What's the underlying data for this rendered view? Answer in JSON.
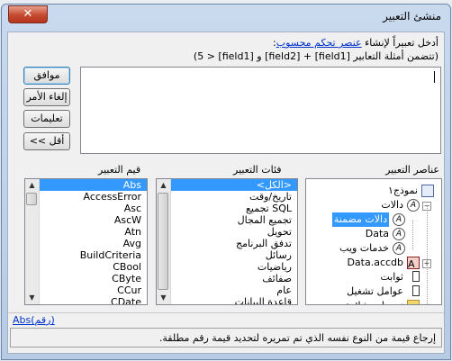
{
  "window": {
    "title": "منشئ التعبير",
    "close_glyph": "✕"
  },
  "instructions": {
    "line1_prefix": "أدخل تعبيراً لإنشاء ",
    "line1_link": "عنصر تحكم محسوب",
    "line1_suffix": ":",
    "line2": "(تتضمن أمثلة التعابير [field1] + [field2] و [field1] < 5)"
  },
  "buttons": {
    "ok": "موافق",
    "cancel": "إلغاء الأمر",
    "help": "تعليمات",
    "less": "<< أقل"
  },
  "panels": {
    "elements_label": "عناصر التعبير",
    "categories_label": "فئات التعبير",
    "values_label": "قيم التعبير"
  },
  "tree": [
    {
      "label": "نموذج١",
      "icon": "form-icon"
    },
    {
      "label": "دالات",
      "icon": "function-icon"
    },
    {
      "label": "دالات مضمنة",
      "icon": "function-icon",
      "selected": true
    },
    {
      "label": "Data",
      "icon": "function-icon"
    },
    {
      "label": "خدمات ويب",
      "icon": "function-icon"
    },
    {
      "label": "Data.accdb",
      "icon": "database-icon"
    },
    {
      "label": "ثوابت",
      "icon": "constant-icon"
    },
    {
      "label": "عوامل تشغيل",
      "icon": "operator-icon"
    },
    {
      "label": "تعبيرات شائعة",
      "icon": "folder-icon"
    }
  ],
  "categories": [
    {
      "label": "<الكل>",
      "selected": true
    },
    {
      "label": "تاريخ/وقت"
    },
    {
      "label": "تجميع SQL"
    },
    {
      "label": "تجميع المجال"
    },
    {
      "label": "تحويل"
    },
    {
      "label": "تدفق البرنامج"
    },
    {
      "label": "رسائل"
    },
    {
      "label": "رياضيات"
    },
    {
      "label": "صفائف"
    },
    {
      "label": "عام"
    },
    {
      "label": "قاعدة البيانات"
    }
  ],
  "values": [
    {
      "label": "Abs",
      "selected": true
    },
    {
      "label": "AccessError"
    },
    {
      "label": "Asc"
    },
    {
      "label": "AscW"
    },
    {
      "label": "Atn"
    },
    {
      "label": "Avg"
    },
    {
      "label": "BuildCriteria"
    },
    {
      "label": "CBool"
    },
    {
      "label": "CByte"
    },
    {
      "label": "CCur"
    },
    {
      "label": "CDate"
    }
  ],
  "footer": {
    "syntax": "Abs(رقم)",
    "description": "إرجاع قيمة من النوع نفسه الذي تم تمريره لتحديد قيمة رقم مطلقة."
  },
  "scroll_glyphs": {
    "up": "▲",
    "down": "▼"
  }
}
